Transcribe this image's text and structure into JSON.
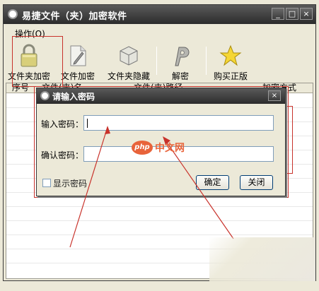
{
  "window": {
    "title": "易捷文件（夹）加密软件",
    "minimize_label": "_",
    "maximize_label": "□",
    "close_label": "×"
  },
  "menu": {
    "items": [
      {
        "label": "操作(O)"
      }
    ]
  },
  "toolbar": {
    "buttons": [
      {
        "label": "文件夹加密",
        "icon": "padlock-icon"
      },
      {
        "label": "文件加密",
        "icon": "pen-document-icon"
      },
      {
        "label": "文件夹隐藏",
        "icon": "box-icon"
      },
      {
        "label": "解密",
        "icon": "p-letter-icon"
      },
      {
        "label": "购买正版",
        "icon": "star-icon"
      }
    ]
  },
  "list": {
    "columns": [
      "序号",
      "文件(夹)名",
      "文件(夹)路径",
      "加密方式"
    ]
  },
  "dialog": {
    "title": "请输入密码",
    "close_label": "×",
    "password_label": "输入密码：",
    "password_value": "",
    "confirm_label": "确认密码：",
    "confirm_value": "",
    "show_password_label": "显示密码",
    "show_password_checked": false,
    "ok_label": "确定",
    "close_button_label": "关闭"
  },
  "watermark": {
    "logo": "php",
    "text": "中文网"
  },
  "colors": {
    "titlebar": "#3a3a3a",
    "annotation": "#c8322b",
    "watermark": "#e8633a",
    "window_bg": "#ece9d8"
  }
}
